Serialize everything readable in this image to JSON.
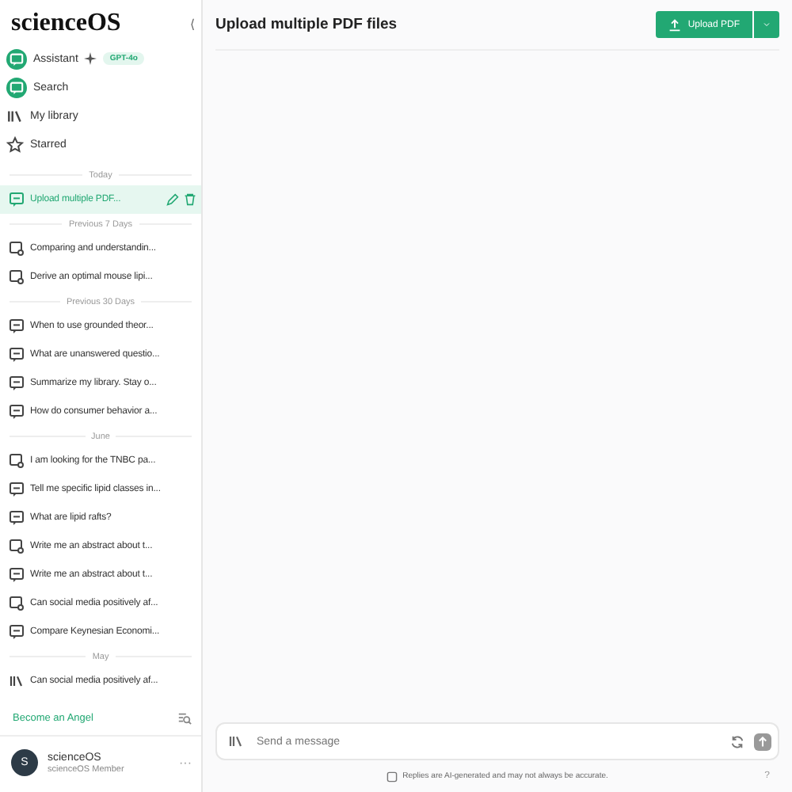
{
  "sidebar": {
    "logo": "scienceOS",
    "collapse": "⟨",
    "nav": [
      {
        "label": "Assistant",
        "kind": "assistant",
        "badge": "GPT-4o"
      },
      {
        "label": "Search",
        "kind": "search"
      },
      {
        "label": "My library",
        "kind": "library"
      },
      {
        "label": "Starred",
        "kind": "star"
      }
    ],
    "sections": [
      {
        "heading": "Today",
        "items": [
          {
            "label": "Upload multiple PDF...",
            "kind": "chat",
            "selected": true
          }
        ]
      },
      {
        "heading": "Previous 7 Days",
        "items": [
          {
            "label": "Comparing and understandin...",
            "kind": "search",
            "selected": false
          },
          {
            "label": "Derive an optimal mouse lipi...",
            "kind": "search",
            "selected": false
          }
        ]
      },
      {
        "heading": "Previous 30 Days",
        "items": [
          {
            "label": "When to use grounded theor...",
            "kind": "chat",
            "selected": false
          },
          {
            "label": "What are unanswered questio...",
            "kind": "chat",
            "selected": false
          },
          {
            "label": "Summarize my library. Stay o...",
            "kind": "chat",
            "selected": false
          },
          {
            "label": "How do consumer behavior a...",
            "kind": "chat",
            "selected": false
          }
        ]
      },
      {
        "heading": "June",
        "items": [
          {
            "label": "I am looking for the TNBC pa...",
            "kind": "search",
            "selected": false
          },
          {
            "label": "Tell me specific lipid classes in...",
            "kind": "chat",
            "selected": false
          },
          {
            "label": "What are lipid rafts?",
            "kind": "chat",
            "selected": false
          },
          {
            "label": "Write me an abstract about t...",
            "kind": "search",
            "selected": false
          },
          {
            "label": "Write me an abstract about t...",
            "kind": "chat",
            "selected": false
          },
          {
            "label": "Can social media positively af...",
            "kind": "search",
            "selected": false
          },
          {
            "label": "Compare Keynesian Economi...",
            "kind": "chat",
            "selected": false
          }
        ]
      },
      {
        "heading": "May",
        "items": [
          {
            "label": "Can social media positively af...",
            "kind": "library",
            "selected": false
          }
        ]
      }
    ],
    "angel": "Become an Angel",
    "user": {
      "initial": "S",
      "name": "scienceOS",
      "role": "scienceOS Member",
      "more": "···"
    }
  },
  "header": {
    "title": "Upload multiple PDF files",
    "button": "Upload PDF"
  },
  "composer": {
    "placeholder": "Send a message",
    "disclaimer": "Replies are AI-generated and may not always be accurate.",
    "help": "?"
  }
}
